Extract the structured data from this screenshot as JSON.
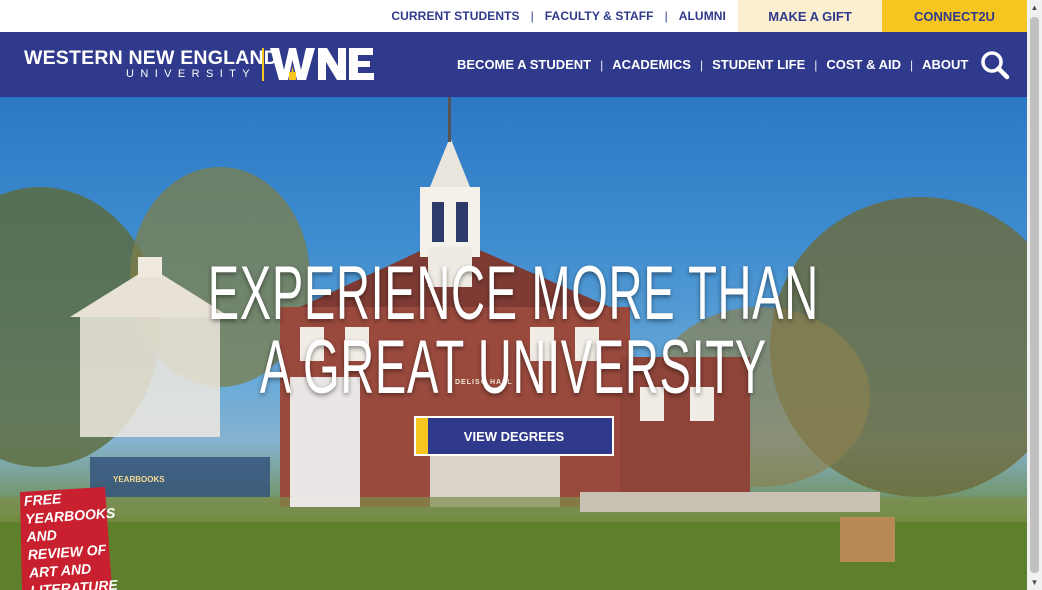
{
  "utility": {
    "links": [
      "CURRENT STUDENTS",
      "FACULTY & STAFF",
      "ALUMNI"
    ],
    "separator": "|",
    "gift_label": "MAKE A GIFT",
    "connect_label": "CONNECT2U"
  },
  "brand": {
    "name_line1": "WESTERN NEW ENGLAND",
    "name_line2": "UNIVERSITY",
    "mark": "WNE",
    "colors": {
      "navy": "#2f3a8c",
      "gold": "#f7c520",
      "cream": "#fcefcf"
    }
  },
  "nav": {
    "items": [
      "BECOME A STUDENT",
      "ACADEMICS",
      "STUDENT LIFE",
      "COST & AID",
      "ABOUT"
    ],
    "separator": "|",
    "search_icon": "search-icon"
  },
  "hero": {
    "headline_line1": "EXPERIENCE MORE THAN",
    "headline_line2": "A GREAT UNIVERSITY",
    "cta_label": "VIEW DEGREES",
    "sign_text": "FREE YEARBOOKS AND REVIEW OF ART AND LITERATURE",
    "building_sign": "DELISO HALL",
    "box_label": "YEARBOOKS"
  }
}
